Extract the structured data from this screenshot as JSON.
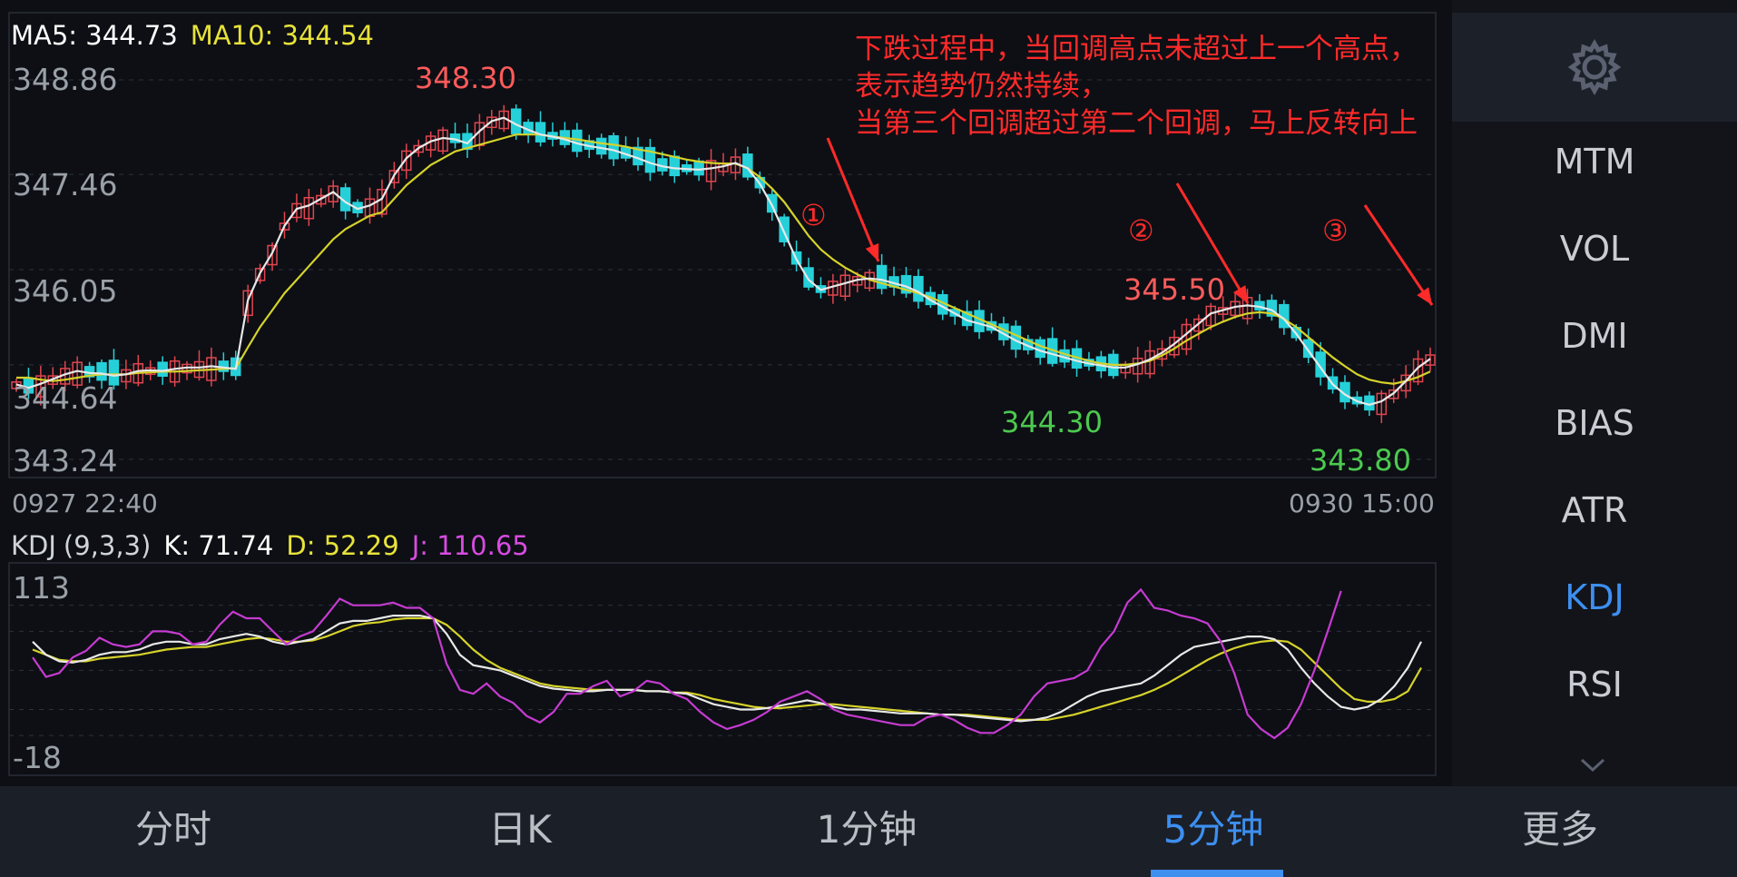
{
  "ma_legend": {
    "ma5": "MA5: 344.73",
    "ma10": "MA10: 344.54"
  },
  "price_axis": [
    "348.86",
    "347.46",
    "346.05",
    "344.64",
    "343.24"
  ],
  "time_axis": {
    "start": "0927 22:40",
    "end": "0930 15:00"
  },
  "annotation": {
    "lines": [
      "下跌过程中，当回调高点未超过上一个高点，",
      "表示趋势仍然持续，",
      "当第三个回调超过第二个回调，马上反转向上"
    ],
    "markers": [
      "①",
      "②",
      "③"
    ]
  },
  "labels": {
    "high": "348.30",
    "low1": "344.30",
    "peak2": "345.50",
    "low2": "343.80"
  },
  "kdj_legend": {
    "name": "KDJ",
    "params": "(9,3,3)",
    "k": "K: 71.74",
    "d": "D: 52.29",
    "j": "J: 110.65"
  },
  "kdj_axis": [
    "113",
    "-18"
  ],
  "sidebar": {
    "items": [
      "MTM",
      "VOL",
      "DMI",
      "BIAS",
      "ATR",
      "KDJ",
      "RSI"
    ],
    "active": "KDJ"
  },
  "tabs": [
    "分时",
    "日K",
    "1分钟",
    "5分钟",
    "更多"
  ],
  "active_tab": "5分钟",
  "colors": {
    "up": "#e0454f",
    "down": "#26d0d9",
    "ma5": "#e8e8e8",
    "ma10": "#d6d22b",
    "k": "#e8e8e8",
    "d": "#d6d22b",
    "j": "#c63bd1",
    "annotation": "#ff2a2a",
    "low_label": "#4cc94f"
  },
  "chart_data": [
    {
      "type": "candlestick",
      "series": [
        {
          "name": "MA5",
          "values": [
            344.35,
            344.3,
            344.36,
            344.43,
            344.5,
            344.55,
            344.52,
            344.51,
            344.48,
            344.5,
            344.55,
            344.56,
            344.55,
            344.58,
            344.6,
            344.6,
            344.62,
            344.6,
            344.58,
            345.6,
            346.0,
            346.3,
            346.7,
            346.95,
            347.0,
            347.1,
            347.2,
            347.05,
            346.95,
            347.0,
            347.1,
            347.45,
            347.7,
            347.85,
            347.95,
            348.0,
            347.98,
            347.92,
            348.1,
            348.25,
            348.3,
            348.2,
            348.12,
            348.05,
            348.02,
            347.98,
            347.92,
            347.88,
            347.85,
            347.82,
            347.76,
            347.7,
            347.63,
            347.58,
            347.55,
            347.54,
            347.53,
            347.55,
            347.58,
            347.63,
            347.55,
            347.32,
            347.0,
            346.6,
            346.2,
            345.9,
            345.75,
            345.8,
            345.85,
            345.9,
            345.92,
            345.9,
            345.85,
            345.8,
            345.72,
            345.6,
            345.5,
            345.4,
            345.3,
            345.25,
            345.2,
            345.1,
            345.0,
            344.92,
            344.85,
            344.8,
            344.75,
            344.7,
            344.66,
            344.63,
            344.6,
            344.6,
            344.65,
            344.72,
            344.82,
            344.95,
            345.1,
            345.25,
            345.4,
            345.45,
            345.5,
            345.52,
            345.5,
            345.45,
            345.32,
            345.1,
            344.85,
            344.6,
            344.35,
            344.2,
            344.1,
            344.05,
            344.1,
            344.22,
            344.4,
            344.6,
            344.73
          ]
        },
        {
          "name": "MA10",
          "values": [
            344.45,
            344.45,
            344.42,
            344.4,
            344.42,
            344.45,
            344.48,
            344.5,
            344.5,
            344.5,
            344.52,
            344.53,
            344.54,
            344.54,
            344.55,
            344.56,
            344.57,
            344.58,
            344.59,
            344.9,
            345.2,
            345.45,
            345.7,
            345.9,
            346.1,
            346.3,
            346.5,
            346.65,
            346.75,
            346.85,
            346.9,
            347.1,
            347.3,
            347.45,
            347.6,
            347.7,
            347.8,
            347.85,
            347.9,
            347.95,
            348.0,
            348.05,
            348.05,
            348.05,
            348.02,
            348.0,
            347.98,
            347.95,
            347.92,
            347.9,
            347.87,
            347.83,
            347.8,
            347.76,
            347.72,
            347.68,
            347.65,
            347.63,
            347.62,
            347.62,
            347.55,
            347.42,
            347.25,
            347.05,
            346.8,
            346.55,
            346.35,
            346.2,
            346.08,
            345.98,
            345.9,
            345.85,
            345.8,
            345.75,
            345.7,
            345.64,
            345.56,
            345.48,
            345.4,
            345.32,
            345.24,
            345.16,
            345.08,
            345.0,
            344.92,
            344.86,
            344.8,
            344.75,
            344.7,
            344.66,
            344.64,
            344.64,
            344.66,
            344.7,
            344.78,
            344.88,
            345.0,
            345.1,
            345.2,
            345.28,
            345.35,
            345.4,
            345.42,
            345.4,
            345.32,
            345.2,
            345.05,
            344.9,
            344.75,
            344.62,
            344.5,
            344.42,
            344.38,
            344.36,
            344.4,
            344.46,
            344.54
          ]
        }
      ],
      "ylim": [
        343.24,
        348.86
      ]
    },
    {
      "type": "line",
      "title": "KDJ (9,3,3)",
      "ylim": [
        -18,
        113
      ],
      "series": [
        {
          "name": "K",
          "values": [
            72,
            62,
            57,
            56,
            58,
            62,
            64,
            64,
            66,
            70,
            72,
            72,
            70,
            70,
            74,
            76,
            78,
            76,
            72,
            70,
            72,
            74,
            80,
            86,
            88,
            88,
            90,
            92,
            92,
            92,
            90,
            78,
            62,
            54,
            52,
            50,
            46,
            42,
            38,
            36,
            35,
            34,
            34,
            35,
            35,
            35,
            34,
            34,
            33,
            32,
            28,
            24,
            22,
            20,
            20,
            21,
            23,
            25,
            27,
            25,
            22,
            20,
            20,
            19,
            18,
            17,
            17,
            17,
            16,
            16,
            15,
            14,
            13,
            12,
            11,
            12,
            14,
            18,
            24,
            30,
            34,
            36,
            38,
            40,
            46,
            54,
            62,
            68,
            70,
            72,
            74,
            76,
            76,
            74,
            66,
            52,
            40,
            30,
            22,
            20,
            22,
            28,
            38,
            52,
            72
          ]
        },
        {
          "name": "D",
          "values": [
            66,
            62,
            58,
            57,
            57,
            59,
            60,
            61,
            62,
            64,
            66,
            67,
            68,
            68,
            70,
            72,
            74,
            75,
            74,
            72,
            72,
            73,
            76,
            80,
            84,
            86,
            87,
            89,
            90,
            90,
            90,
            85,
            76,
            66,
            58,
            52,
            48,
            44,
            40,
            38,
            37,
            36,
            35,
            35,
            35,
            35,
            34,
            34,
            33,
            33,
            31,
            28,
            26,
            24,
            22,
            21,
            21,
            22,
            23,
            24,
            24,
            23,
            22,
            21,
            20,
            19,
            18,
            17,
            16,
            16,
            16,
            15,
            14,
            13,
            12,
            12,
            12,
            14,
            16,
            19,
            22,
            25,
            28,
            31,
            35,
            40,
            46,
            52,
            58,
            63,
            67,
            70,
            72,
            73,
            72,
            66,
            56,
            46,
            36,
            28,
            26,
            26,
            28,
            34,
            52
          ]
        },
        {
          "name": "J",
          "values": [
            60,
            45,
            48,
            60,
            65,
            75,
            70,
            68,
            70,
            80,
            80,
            78,
            70,
            72,
            85,
            95,
            90,
            90,
            80,
            70,
            76,
            80,
            92,
            105,
            100,
            100,
            100,
            102,
            98,
            98,
            90,
            55,
            35,
            32,
            40,
            30,
            25,
            15,
            10,
            18,
            32,
            32,
            38,
            42,
            30,
            34,
            42,
            40,
            32,
            28,
            18,
            10,
            5,
            8,
            12,
            18,
            26,
            30,
            34,
            28,
            20,
            16,
            14,
            12,
            10,
            8,
            8,
            14,
            16,
            12,
            6,
            2,
            2,
            8,
            16,
            30,
            40,
            42,
            44,
            50,
            68,
            80,
            102,
            112,
            98,
            96,
            92,
            90,
            86,
            72,
            48,
            16,
            5,
            -2,
            6,
            24,
            50,
            80,
            111
          ]
        }
      ]
    }
  ]
}
